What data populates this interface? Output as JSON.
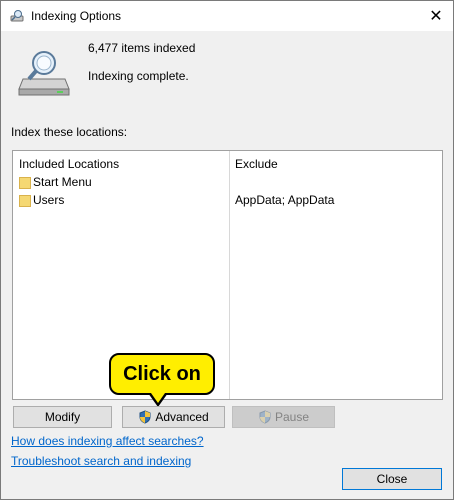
{
  "window": {
    "title": "Indexing Options"
  },
  "status": {
    "items_indexed": "6,477 items indexed",
    "message": "Indexing complete."
  },
  "locations": {
    "label": "Index these locations:",
    "columns": {
      "included": "Included Locations",
      "exclude": "Exclude"
    },
    "rows": [
      {
        "name": "Start Menu",
        "exclude": ""
      },
      {
        "name": "Users",
        "exclude": "AppData; AppData"
      }
    ]
  },
  "buttons": {
    "modify": "Modify",
    "advanced": "Advanced",
    "pause": "Pause",
    "close": "Close"
  },
  "links": {
    "how_affect": "How does indexing affect searches?",
    "troubleshoot": "Troubleshoot search and indexing"
  },
  "callout": {
    "text": "Click on"
  },
  "colors": {
    "accent": "#0078d7",
    "link": "#0066cc",
    "callout_fill": "#ffee00",
    "folder": "#f5d873"
  }
}
